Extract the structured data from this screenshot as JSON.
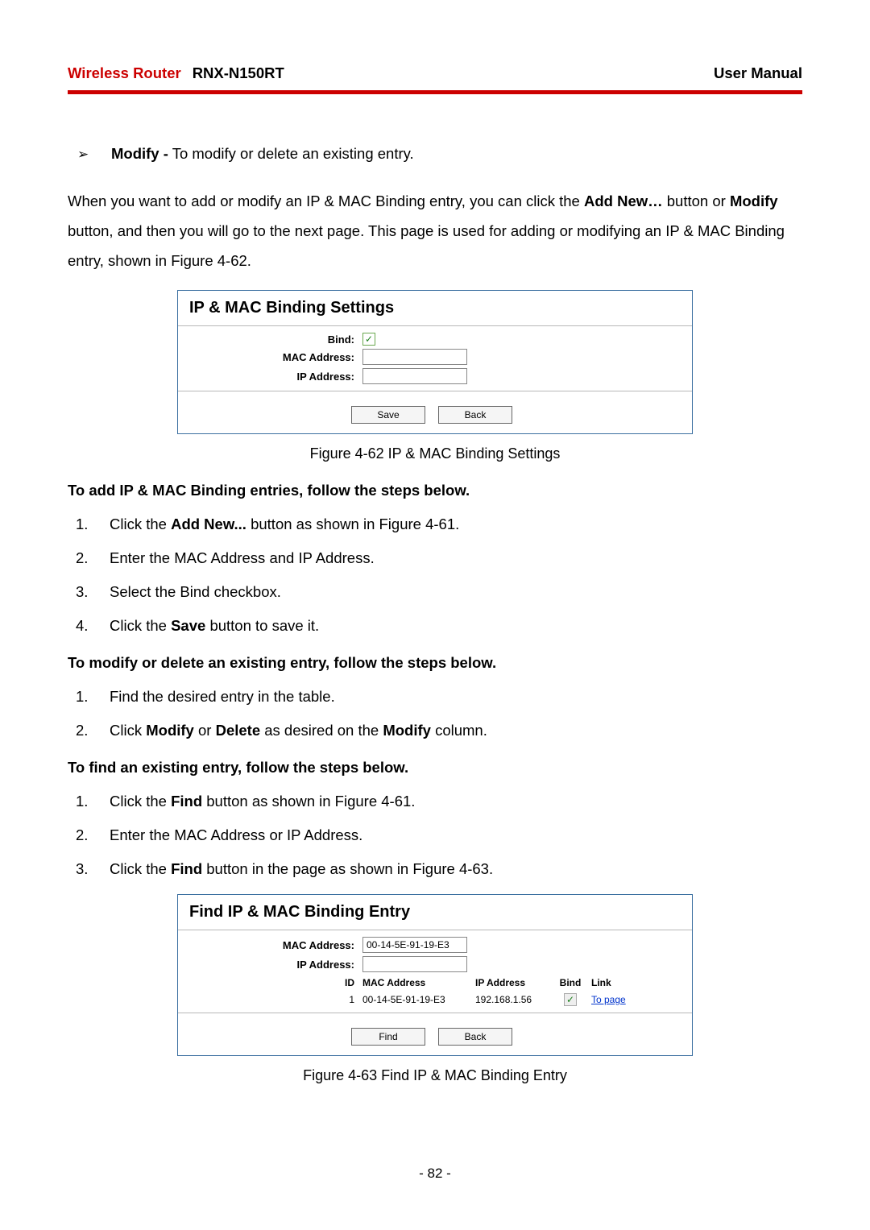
{
  "header": {
    "brand": "Wireless Router",
    "model": "RNX-N150RT",
    "manual": "User Manual"
  },
  "modify_bullet": {
    "mark": "➢",
    "term": "Modify -",
    "desc": " To modify or delete an existing entry."
  },
  "intro": {
    "pre": "When you want to add or modify an IP & MAC Binding entry, you can click the ",
    "addnew": "Add New…",
    "mid1": " button or ",
    "modify": "Modify",
    "mid2": " button, and then you will go to the next page. This page is used for adding or modifying an IP & MAC Binding entry, shown in Figure 4-62."
  },
  "fig1": {
    "title": "IP & MAC Binding Settings",
    "labels": {
      "bind": "Bind:",
      "mac": "MAC Address:",
      "ip": "IP Address:"
    },
    "buttons": {
      "save": "Save",
      "back": "Back"
    },
    "values": {
      "mac": "",
      "ip": ""
    },
    "caption": "Figure 4-62 IP & MAC Binding Settings"
  },
  "add_steps": {
    "heading": "To add IP & MAC Binding entries, follow the steps below.",
    "items": {
      "1a": "Click the ",
      "1b": "Add New...",
      "1c": " button as shown in Figure 4-61.",
      "2": "Enter the MAC Address and IP Address.",
      "3": "Select the Bind checkbox.",
      "4a": "Click the ",
      "4b": "Save",
      "4c": " button to save it."
    }
  },
  "modify_steps": {
    "heading": "To modify or delete an existing entry, follow the steps below.",
    "items": {
      "1": "Find the desired entry in the table.",
      "2a": "Click ",
      "2b": "Modify",
      "2c": " or ",
      "2d": "Delete",
      "2e": " as desired on the ",
      "2f": "Modify",
      "2g": " column."
    }
  },
  "find_steps": {
    "heading": "To find an existing entry, follow the steps below.",
    "items": {
      "1a": "Click the ",
      "1b": "Find",
      "1c": " button as shown in Figure 4-61.",
      "2": "Enter the MAC Address or IP Address.",
      "3a": "Click the ",
      "3b": "Find",
      "3c": " button in the page as shown in Figure 4-63."
    }
  },
  "fig2": {
    "title": "Find IP & MAC Binding Entry",
    "labels": {
      "mac": "MAC Address:",
      "ip": "IP Address:",
      "id": "ID"
    },
    "values": {
      "mac": "00-14-5E-91-19-E3",
      "ip": ""
    },
    "table_headers": {
      "mac": "MAC Address",
      "ip": "IP Address",
      "bind": "Bind",
      "link": "Link"
    },
    "row": {
      "id": "1",
      "mac": "00-14-5E-91-19-E3",
      "ip": "192.168.1.56",
      "link": "To page"
    },
    "buttons": {
      "find": "Find",
      "back": "Back"
    },
    "caption": "Figure 4-63 Find IP & MAC Binding Entry"
  },
  "page_number": "- 82 -",
  "nums": {
    "1": "1.",
    "2": "2.",
    "3": "3.",
    "4": "4."
  }
}
